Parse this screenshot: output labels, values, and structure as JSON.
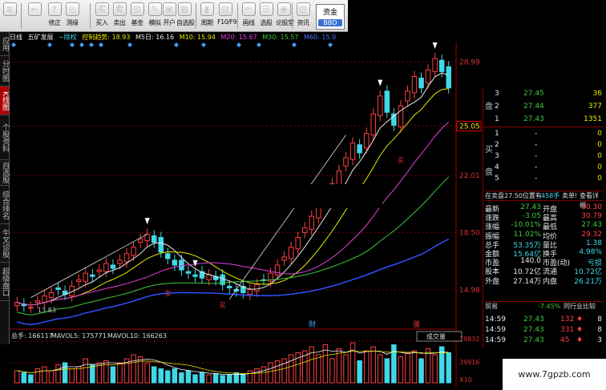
{
  "toolbar": {
    "buttons": [
      {
        "label": "",
        "glyph": "≡"
      },
      {
        "label": "",
        "glyph": "←"
      },
      {
        "label": "修正",
        "glyph": "↑"
      },
      {
        "label": "测缘",
        "glyph": "◎"
      },
      {
        "label": "买入",
        "glyph": "买"
      },
      {
        "label": "卖出",
        "glyph": "卖"
      },
      {
        "label": "基金",
        "glyph": "▥"
      },
      {
        "label": "模拟",
        "glyph": "✎"
      },
      {
        "label": "开户",
        "glyph": "▣"
      },
      {
        "label": "自选股",
        "glyph": "▦"
      },
      {
        "label": "周期",
        "glyph": "▮"
      },
      {
        "label": "F10/F9",
        "glyph": "▤"
      },
      {
        "label": "画线",
        "glyph": "✏"
      },
      {
        "label": "选股",
        "glyph": "☰"
      },
      {
        "label": "论股堂",
        "glyph": "◉"
      },
      {
        "label": "资讯",
        "glyph": "▧"
      }
    ],
    "fund_label": "资金",
    "bbd_label": "BBD"
  },
  "left_tabs": [
    {
      "label": "应用",
      "active": false
    },
    {
      "label": "分时图",
      "active": false
    },
    {
      "label": "K线图",
      "active": true
    },
    {
      "label": "个股资料",
      "active": false
    },
    {
      "label": "自选股",
      "active": false
    },
    {
      "label": "综合排名",
      "active": false
    },
    {
      "label": "牛叉诊股",
      "active": false
    },
    {
      "label": "超级盘口",
      "active": false
    }
  ],
  "info_bar": {
    "period": "日线",
    "stock_name": "五矿发展",
    "rights": "~除权",
    "ma_text": "控制趋势: 18.93",
    "m5": "M5日: 16.16",
    "m10": "M10: 15.94",
    "m20": "M20: 15.67",
    "m30": "M30: 15.57",
    "m60": "M60: 15.0"
  },
  "chart_data": {
    "type": "candlestick",
    "price_axis": [
      "28.99",
      "25.05",
      "22.01",
      "18.50",
      "14.98"
    ],
    "current_price_label": "25.05",
    "low_label": "13.83",
    "volume_axis": [
      "79832",
      "39916",
      "X10"
    ],
    "volume_bar": {
      "total": "总手: 166117",
      "mavol5": "MAVOL5: 175771",
      "mavol10": "MAVOL10: 166263",
      "selector": "成交量"
    },
    "markers": [
      "财",
      "涨"
    ],
    "annotations": [
      "买",
      "买",
      "买"
    ],
    "closes": [
      14.2,
      14.0,
      13.9,
      14.3,
      14.6,
      14.8,
      15.0,
      14.7,
      15.2,
      15.6,
      16.0,
      15.8,
      16.2,
      16.6,
      16.3,
      16.8,
      17.2,
      17.6,
      18.1,
      18.4,
      17.9,
      17.3,
      16.9,
      16.5,
      16.2,
      16.0,
      15.8,
      15.7,
      15.9,
      15.6,
      15.3,
      15.1,
      14.9,
      14.8,
      15.0,
      15.3,
      15.6,
      16.0,
      16.5,
      17.0,
      17.6,
      18.2,
      18.8,
      19.5,
      20.1,
      20.8,
      21.5,
      22.3,
      23.1,
      24.0,
      23.4,
      24.6,
      25.8,
      26.9,
      25.9,
      25.1,
      26.3,
      27.2,
      28.1,
      27.4,
      28.5,
      29.2,
      28.4,
      27.4
    ],
    "volumes": [
      0.3,
      0.25,
      0.2,
      0.35,
      0.4,
      0.3,
      0.45,
      0.5,
      0.35,
      0.4,
      0.6,
      0.45,
      0.5,
      0.55,
      0.4,
      0.5,
      0.6,
      0.7,
      0.65,
      0.5,
      0.4,
      0.35,
      0.3,
      0.35,
      0.25,
      0.3,
      0.2,
      0.25,
      0.2,
      0.22,
      0.18,
      0.2,
      0.25,
      0.22,
      0.3,
      0.35,
      0.4,
      0.5,
      0.55,
      0.6,
      0.7,
      0.75,
      0.8,
      0.9,
      0.7,
      0.95,
      0.6,
      0.85,
      0.7,
      1.0,
      0.55,
      0.8,
      0.9,
      0.7,
      0.6,
      0.95,
      0.65,
      0.75,
      0.8,
      0.6,
      0.85,
      0.7,
      0.9,
      0.75
    ]
  },
  "order_book": {
    "sell": [
      {
        "level": "3",
        "price": "27.45",
        "qty": "36"
      },
      {
        "level": "2",
        "price": "27.44",
        "qty": "377"
      },
      {
        "level": "1",
        "price": "27.43",
        "qty": "1351"
      }
    ],
    "buy": [
      {
        "level": "1",
        "price": "-",
        "qty": "0"
      },
      {
        "level": "2",
        "price": "-",
        "qty": "0"
      },
      {
        "level": "3",
        "price": "-",
        "qty": "0"
      },
      {
        "level": "4",
        "price": "-",
        "qty": "0"
      },
      {
        "level": "5",
        "price": "-",
        "qty": "0"
      }
    ],
    "sell_side_label": "盘",
    "buy_side_top": "买",
    "buy_side_bottom": "盘"
  },
  "pending_header": {
    "text": "在卖盘27.50位置有",
    "count": "458手",
    "sell_label": "卖单!",
    "detail_label": "查看详细"
  },
  "quote_stats": [
    {
      "l1": "最新",
      "v1": "27.43",
      "l2": "开盘",
      "v2": "30.30"
    },
    {
      "l1": "涨跌",
      "v1": "-3.05",
      "l2": "最高",
      "v2": "30.79"
    },
    {
      "l1": "涨幅",
      "v1": "-10.01%",
      "l2": "最低",
      "v2": "27.43"
    },
    {
      "l1": "振幅",
      "v1": "11.02%",
      "l2": "均价",
      "v2": "29.32"
    },
    {
      "l1": "总手",
      "v1": "53.35万",
      "l2": "量比",
      "v2": "1.38"
    },
    {
      "l1": "金额",
      "v1": "15.64亿",
      "l2": "换手",
      "v2": "4.98%"
    },
    {
      "l1": "市盈",
      "v1": "140.0",
      "l2": "市盈(动)",
      "v2": "亏损"
    },
    {
      "l1": "股本",
      "v1": "10.72亿",
      "l2": "流通",
      "v2": "10.72亿"
    },
    {
      "l1": "外盘",
      "v1": "27.14万",
      "l2": "内盘",
      "v2": "26.21万"
    }
  ],
  "trade_header": {
    "label": "贸易",
    "pct": "-7.45%",
    "compare": "同行业比较"
  },
  "trades": [
    {
      "time": "14:59",
      "price": "27.43",
      "qty": "132",
      "dir": "♦",
      "n": "8"
    },
    {
      "time": "14:59",
      "price": "27.43",
      "qty": "331",
      "dir": "♦",
      "n": "8"
    },
    {
      "time": "14:59",
      "price": "27.43",
      "qty": "45",
      "dir": "♦",
      "n": "3"
    }
  ],
  "watermark": "www.7gpzb.com",
  "colors": {
    "up": "#ff4040",
    "down": "#40d8e8",
    "ma5": "#e8e8e8",
    "ma10": "#e8e800",
    "ma20": "#e040e0",
    "ma30": "#3ec83e",
    "ma60": "#3050ff"
  }
}
